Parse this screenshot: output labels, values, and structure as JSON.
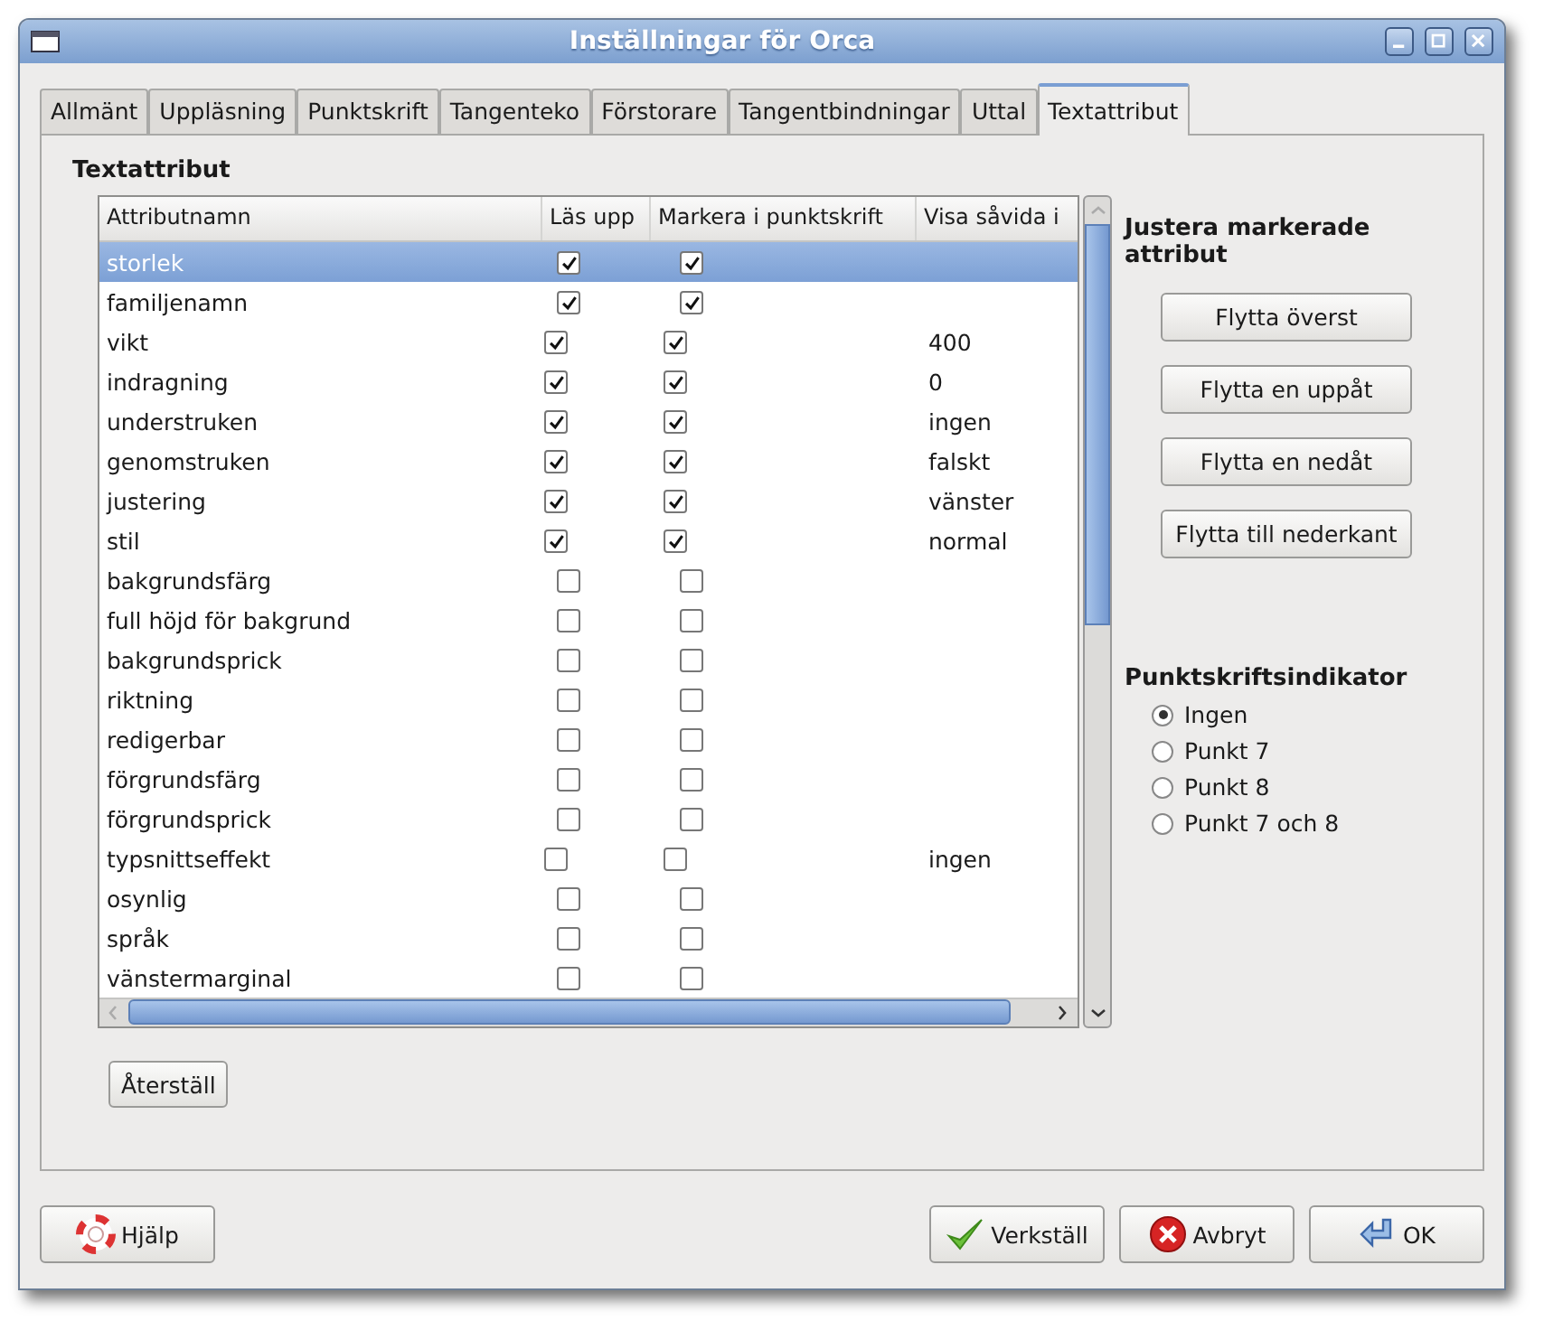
{
  "window": {
    "title": "Inställningar för Orca"
  },
  "tabs": [
    {
      "label": "Allmänt",
      "selected": false
    },
    {
      "label": "Uppläsning",
      "selected": false
    },
    {
      "label": "Punktskrift",
      "selected": false
    },
    {
      "label": "Tangenteko",
      "selected": false
    },
    {
      "label": "Förstorare",
      "selected": false
    },
    {
      "label": "Tangentbindningar",
      "selected": false
    },
    {
      "label": "Uttal",
      "selected": false
    },
    {
      "label": "Textattribut",
      "selected": true
    }
  ],
  "section_title": "Textattribut",
  "table": {
    "columns": [
      "Attributnamn",
      "Läs upp",
      "Markera i punktskrift",
      "Visa såvida i"
    ],
    "rows": [
      {
        "name": "storlek",
        "speak": true,
        "braille": true,
        "selected": true
      },
      {
        "name": "familjenamn",
        "speak": true,
        "braille": true,
        "selected": false
      },
      {
        "name": "vikt",
        "speak": true,
        "braille": true,
        "value": "400",
        "selected": false
      },
      {
        "name": "indragning",
        "speak": true,
        "braille": true,
        "value": "0",
        "selected": false
      },
      {
        "name": "understruken",
        "speak": true,
        "braille": true,
        "value": "ingen",
        "selected": false
      },
      {
        "name": "genomstruken",
        "speak": true,
        "braille": true,
        "value": "falskt",
        "selected": false
      },
      {
        "name": "justering",
        "speak": true,
        "braille": true,
        "value": "vänster",
        "selected": false
      },
      {
        "name": "stil",
        "speak": true,
        "braille": true,
        "value": "normal",
        "selected": false
      },
      {
        "name": "bakgrundsfärg",
        "speak": false,
        "braille": false,
        "selected": false
      },
      {
        "name": "full höjd för bakgrund",
        "speak": false,
        "braille": false,
        "selected": false
      },
      {
        "name": "bakgrundsprick",
        "speak": false,
        "braille": false,
        "selected": false
      },
      {
        "name": "riktning",
        "speak": false,
        "braille": false,
        "selected": false
      },
      {
        "name": "redigerbar",
        "speak": false,
        "braille": false,
        "selected": false
      },
      {
        "name": "förgrundsfärg",
        "speak": false,
        "braille": false,
        "selected": false
      },
      {
        "name": "förgrundsprick",
        "speak": false,
        "braille": false,
        "selected": false
      },
      {
        "name": "typsnittseffekt",
        "speak": false,
        "braille": false,
        "value": "ingen",
        "selected": false
      },
      {
        "name": "osynlig",
        "speak": false,
        "braille": false,
        "selected": false
      },
      {
        "name": "språk",
        "speak": false,
        "braille": false,
        "selected": false
      },
      {
        "name": "vänstermarginal",
        "speak": false,
        "braille": false,
        "selected": false
      }
    ]
  },
  "reset_button": "Återställ",
  "adjust": {
    "title": "Justera markerade attribut",
    "buttons": [
      "Flytta överst",
      "Flytta en uppåt",
      "Flytta en nedåt",
      "Flytta till nederkant"
    ]
  },
  "indicator": {
    "title": "Punktskriftsindikator",
    "options": [
      {
        "label": "Ingen",
        "selected": true
      },
      {
        "label": "Punkt 7",
        "selected": false
      },
      {
        "label": "Punkt 8",
        "selected": false
      },
      {
        "label": "Punkt 7 och 8",
        "selected": false
      }
    ]
  },
  "footer": {
    "buttons": [
      {
        "label": "Hjälp",
        "kind": "help"
      },
      {
        "label": "Verkställ",
        "kind": "apply"
      },
      {
        "label": "Avbryt",
        "kind": "cancel"
      },
      {
        "label": "OK",
        "kind": "ok"
      }
    ]
  }
}
